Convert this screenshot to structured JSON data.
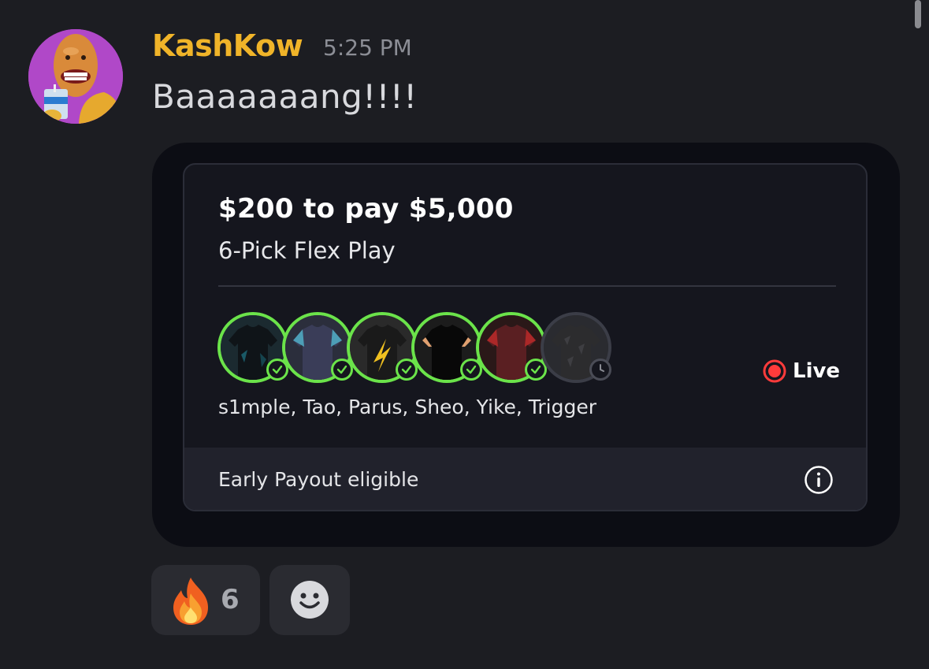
{
  "message": {
    "username": "KashKow",
    "username_color": "#f0b429",
    "timestamp": "5:25 PM",
    "text": "Baaaaaaang!!!!",
    "avatar": "cartoon-avatar-juice-pouch"
  },
  "card": {
    "title": "$200 to pay $5,000",
    "subtitle": "6-Pick Flex Play",
    "picks_label": "s1mple, Tao, Parus, Sheo, Yike, Trigger",
    "picks": [
      {
        "status": "won",
        "icon": "jersey-icon"
      },
      {
        "status": "won",
        "icon": "jersey-icon"
      },
      {
        "status": "won",
        "icon": "jersey-icon"
      },
      {
        "status": "won",
        "icon": "jersey-icon"
      },
      {
        "status": "won",
        "icon": "jersey-icon"
      },
      {
        "status": "pending",
        "icon": "jersey-icon"
      }
    ],
    "status_label": "Live",
    "status_color": "#ff3b3b",
    "accent_color": "#6be34a",
    "footer_text": "Early Payout eligible",
    "footer_icon": "info-icon"
  },
  "reactions": [
    {
      "emoji": "fire",
      "count": "6"
    }
  ],
  "add_reaction_icon": "smiley-icon"
}
